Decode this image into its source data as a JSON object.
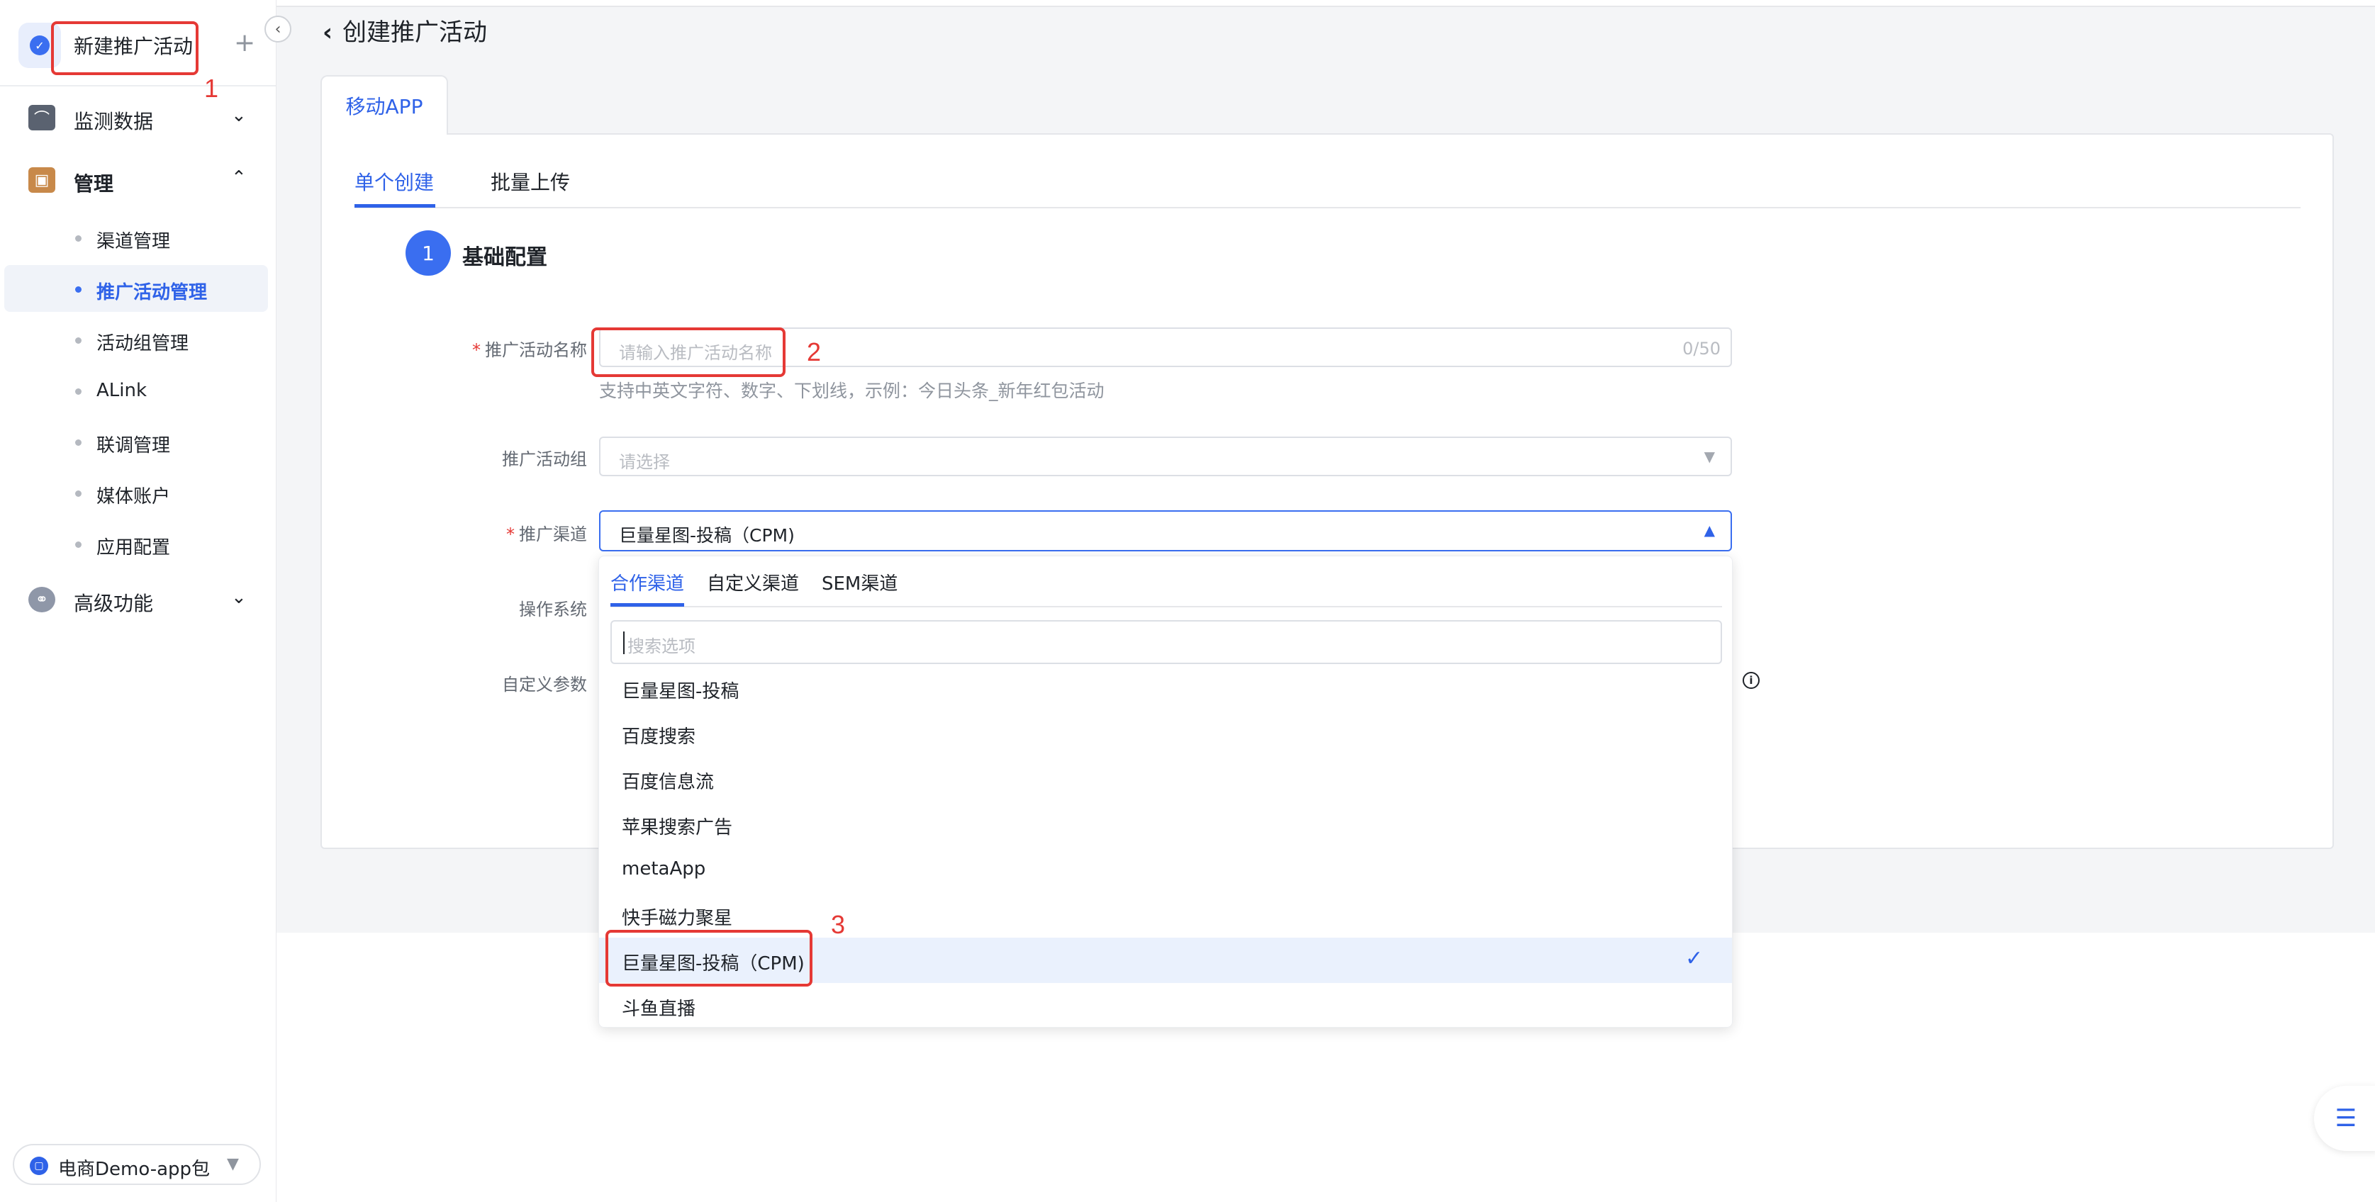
{
  "sidebar": {
    "current_tab": "新建推广活动",
    "groups": [
      {
        "label": "监测数据"
      },
      {
        "label": "管理"
      },
      {
        "label": "高级功能"
      }
    ],
    "manage_items": [
      {
        "label": "渠道管理"
      },
      {
        "label": "推广活动管理"
      },
      {
        "label": "活动组管理"
      },
      {
        "label": "ALink"
      },
      {
        "label": "联调管理"
      },
      {
        "label": "媒体账户"
      },
      {
        "label": "应用配置"
      }
    ],
    "app_switcher": "电商Demo-app包"
  },
  "header": {
    "title": "创建推广活动"
  },
  "main": {
    "platform_tab": "移动APP",
    "subtabs": [
      {
        "label": "单个创建"
      },
      {
        "label": "批量上传"
      }
    ],
    "step": {
      "number": "1",
      "title": "基础配置"
    },
    "form": {
      "name_label": "推广活动名称",
      "name_placeholder": "请输入推广活动名称",
      "name_count": "0/50",
      "name_help": "支持中英文字符、数字、下划线，示例：今日头条_新年红包活动",
      "group_label": "推广活动组",
      "group_placeholder": "请选择",
      "channel_label": "推广渠道",
      "channel_value": "巨量星图-投稿（CPM)",
      "os_label": "操作系统",
      "params_label": "自定义参数"
    }
  },
  "dropdown": {
    "tabs": [
      {
        "label": "合作渠道"
      },
      {
        "label": "自定义渠道"
      },
      {
        "label": "SEM渠道"
      }
    ],
    "search_placeholder": "搜索选项",
    "options": [
      {
        "label": "巨量星图-投稿"
      },
      {
        "label": "百度搜索"
      },
      {
        "label": "百度信息流"
      },
      {
        "label": "苹果搜索广告"
      },
      {
        "label": "metaApp"
      },
      {
        "label": "快手磁力聚星"
      },
      {
        "label": "巨量星图-投稿（CPM)",
        "selected": true
      },
      {
        "label": "斗鱼直播"
      }
    ]
  },
  "annotations": [
    "1",
    "2",
    "3"
  ],
  "colors": {
    "accent": "#2f62e8",
    "annotation": "#e53935",
    "selected_bg": "#eaf1fd"
  }
}
